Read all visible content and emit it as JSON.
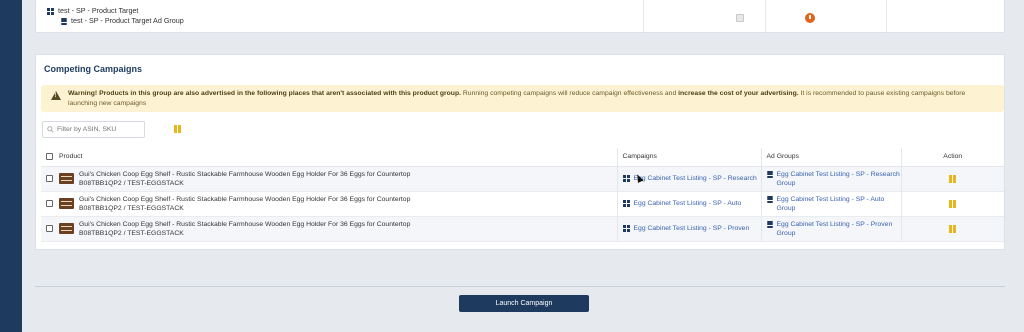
{
  "top_row": {
    "campaign": "test - SP - Product Target",
    "ad_group": "test - SP - Product Target Ad Group"
  },
  "section": {
    "title": "Competing Campaigns"
  },
  "warning": {
    "bold1": "Warning! Products in this group are also advertised in the following places that aren't associated with this product group.",
    "text1": " Running competing campaigns will reduce campaign effectiveness and ",
    "bold2": "increase the cost of your advertising.",
    "text2": " It is recommended to pause existing campaigns before launching new campaigns"
  },
  "filter": {
    "placeholder": "Filter by ASIN, SKU"
  },
  "table": {
    "headers": {
      "product": "Product",
      "campaigns": "Campaigns",
      "ad_groups": "Ad Groups",
      "action": "Action"
    },
    "rows": [
      {
        "product_name": "Gui's Chicken Coop Egg Shelf - Rustic Stackable Farmhouse Wooden Egg Holder For 36 Eggs for Countertop",
        "product_ids": "B08TBB1QP2 / TEST-EGGSTACK",
        "campaign": "Egg Cabinet Test Listing - SP - Research",
        "ad_group": "Egg Cabinet Test Listing - SP - Research Group"
      },
      {
        "product_name": "Gui's Chicken Coop Egg Shelf - Rustic Stackable Farmhouse Wooden Egg Holder For 36 Eggs for Countertop",
        "product_ids": "B08TBB1QP2 / TEST-EGGSTACK",
        "campaign": "Egg Cabinet Test Listing - SP - Auto",
        "ad_group": "Egg Cabinet Test Listing - SP - Auto Group"
      },
      {
        "product_name": "Gui's Chicken Coop Egg Shelf - Rustic Stackable Farmhouse Wooden Egg Holder For 36 Eggs for Countertop",
        "product_ids": "B08TBB1QP2 / TEST-EGGSTACK",
        "campaign": "Egg Cabinet Test Listing - SP - Proven",
        "ad_group": "Egg Cabinet Test Listing - SP - Proven Group"
      }
    ]
  },
  "footer": {
    "launch_label": "Launch Campaign"
  },
  "colors": {
    "navy": "#1e3a5f",
    "link": "#3a62b0",
    "warning_bg": "#fdf3d2",
    "pause_yellow": "#e8b619",
    "clock_orange": "#e0651b"
  }
}
